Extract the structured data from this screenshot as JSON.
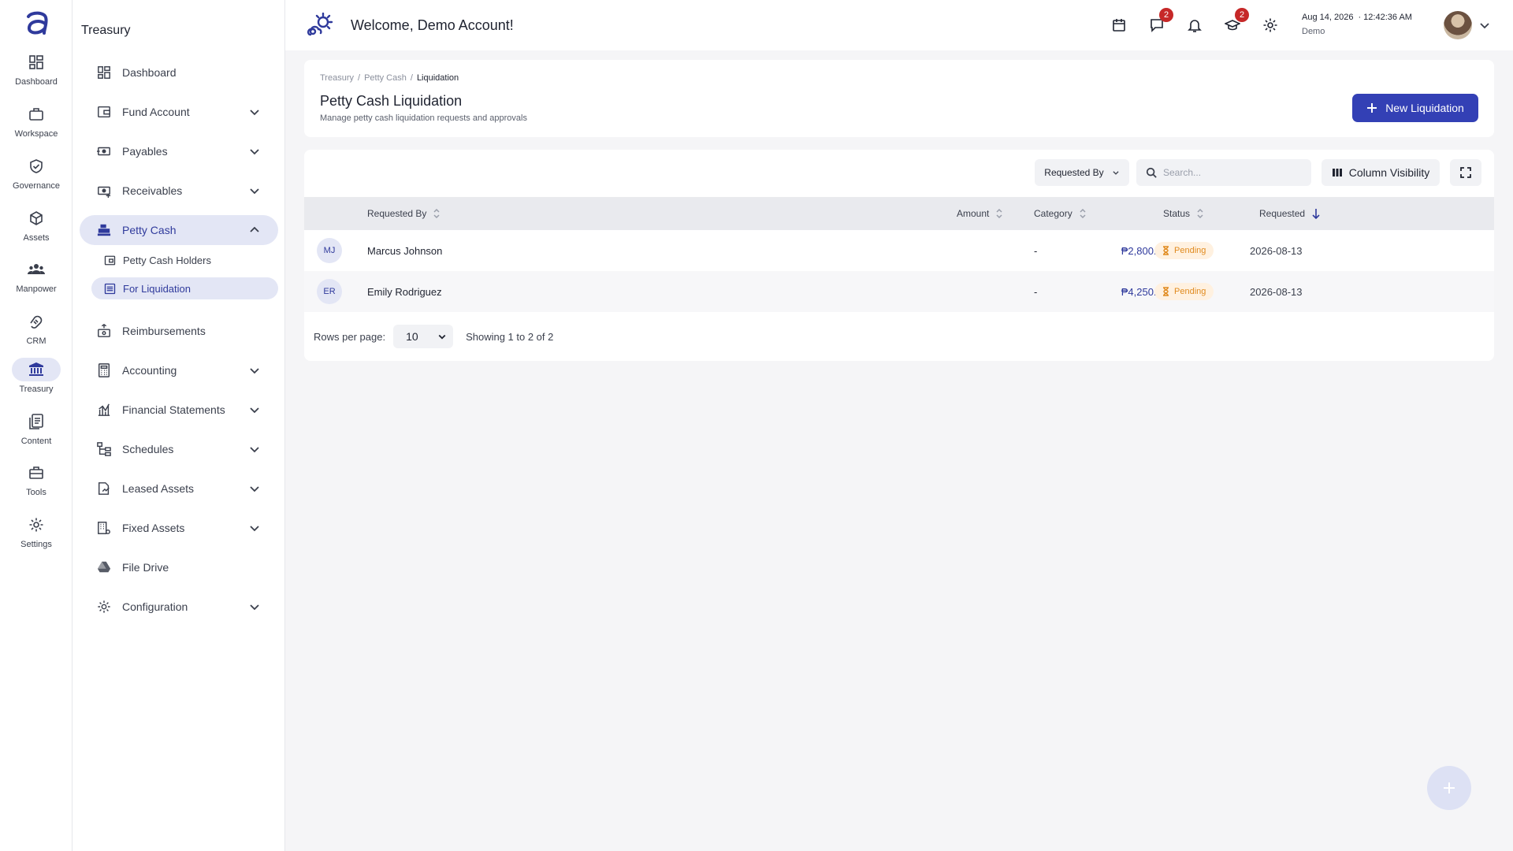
{
  "rail": {
    "items": [
      {
        "label": "Dashboard",
        "icon": "dashboard-icon"
      },
      {
        "label": "Workspace",
        "icon": "briefcase-icon"
      },
      {
        "label": "Governance",
        "icon": "shield-check-icon"
      },
      {
        "label": "Assets",
        "icon": "box-icon"
      },
      {
        "label": "Manpower",
        "icon": "people-icon"
      },
      {
        "label": "CRM",
        "icon": "handshake-icon"
      },
      {
        "label": "Treasury",
        "icon": "bank-icon"
      },
      {
        "label": "Content",
        "icon": "document-icon"
      },
      {
        "label": "Tools",
        "icon": "toolbox-icon"
      },
      {
        "label": "Settings",
        "icon": "gear-icon"
      }
    ],
    "active": "Treasury"
  },
  "sidebar": {
    "title": "Treasury",
    "items": [
      {
        "label": "Dashboard"
      },
      {
        "label": "Fund Account"
      },
      {
        "label": "Payables"
      },
      {
        "label": "Receivables"
      },
      {
        "label": "Petty Cash"
      },
      {
        "label": "Reimbursements"
      },
      {
        "label": "Accounting"
      },
      {
        "label": "Financial Statements"
      },
      {
        "label": "Schedules"
      },
      {
        "label": "Leased Assets"
      },
      {
        "label": "Fixed Assets"
      },
      {
        "label": "File Drive"
      },
      {
        "label": "Configuration"
      }
    ],
    "sub_items": [
      {
        "label": "Petty Cash Holders"
      },
      {
        "label": "For Liquidation"
      }
    ]
  },
  "topbar": {
    "welcome": "Welcome, Demo Account!",
    "messages_badge": "2",
    "training_badge": "2",
    "date": "Aug 14, 2026",
    "time": "· 12:42:36 AM",
    "role": "Demo"
  },
  "header": {
    "breadcrumb": [
      "Treasury",
      "Petty Cash",
      "Liquidation"
    ],
    "title": "Petty Cash Liquidation",
    "subtitle": "Manage petty cash liquidation requests and approvals",
    "new_button": "New Liquidation"
  },
  "toolbar": {
    "filter_label": "Requested By",
    "search_placeholder": "Search...",
    "column_visibility": "Column Visibility"
  },
  "table": {
    "columns": [
      "Requested By",
      "Amount",
      "Category",
      "Status",
      "Requested"
    ],
    "rows": [
      {
        "initials": "MJ",
        "name": "Marcus Johnson",
        "amount": "₱2,800.00",
        "category": "-",
        "status": "Pending",
        "requested": "2026-08-13"
      },
      {
        "initials": "ER",
        "name": "Emily Rodriguez",
        "amount": "₱4,250.00",
        "category": "-",
        "status": "Pending",
        "requested": "2026-08-13"
      }
    ]
  },
  "pagination": {
    "rows_per_page_label": "Rows per page:",
    "rows_per_page": "10",
    "showing": "Showing 1 to 2 of 2"
  },
  "colors": {
    "accent": "#3340b5",
    "active_bg": "#e3e6f5",
    "pending": "#e08a1e"
  }
}
